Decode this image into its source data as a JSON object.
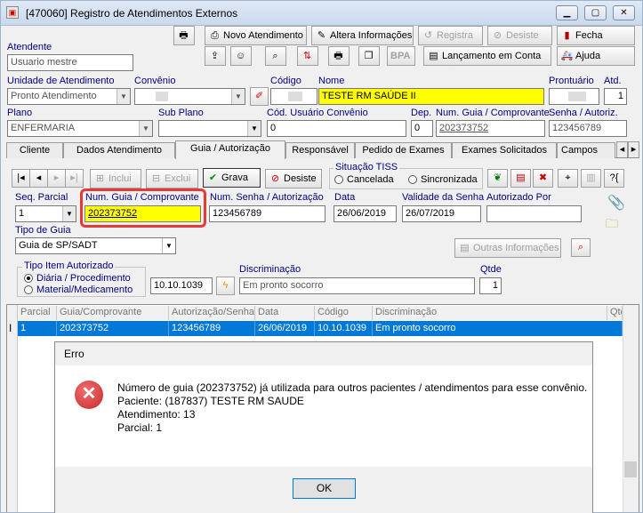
{
  "window": {
    "title": "[470060]  Registro de Atendimentos Externos"
  },
  "toolbar": {
    "novo": "Novo Atendimento",
    "alterar": "Altera Informações",
    "registra": "Registra",
    "desiste": "Desiste",
    "fecha": "Fecha",
    "bpa": "BPA",
    "lancamento": "Lançamento em Conta",
    "ajuda": "Ajuda"
  },
  "header": {
    "atendente_label": "Atendente",
    "atendente_value": "Usuario mestre",
    "unidade_label": "Unidade de Atendimento",
    "unidade_value": "Pronto Atendimento",
    "convenio_label": "Convênio",
    "codigo_label": "Código",
    "nome_label": "Nome",
    "nome_value": "TESTE RM SAÚDE II",
    "prontuario_label": "Prontuário",
    "atd_label": "Atd.",
    "atd_value": "1",
    "plano_label": "Plano",
    "plano_value": "ENFERMARIA",
    "subplano_label": "Sub Plano",
    "codusuario_label": "Cód. Usuário Convênio",
    "codusuario_value": "0",
    "dep_label": "Dep.",
    "dep_value": "0",
    "numguia_label": "Num. Guia / Comprovante",
    "numguia_value": "202373752",
    "senha_label": "Senha / Autoriz.",
    "senha_value": "123456789"
  },
  "tabs": [
    "Cliente",
    "Dados Atendimento",
    "Guia / Autorização",
    "Responsável",
    "Pedido de Exames",
    "Exames Solicitados",
    "Campos Com"
  ],
  "guia": {
    "incluir": "Inclui",
    "excluir": "Exclui",
    "grava": "Grava",
    "desiste": "Desiste",
    "situacao_label": "Situação TISS",
    "cancelada": "Cancelada",
    "sincronizada": "Sincronizada",
    "seq_label": "Seq. Parcial",
    "seq_value": "1",
    "numguia_label": "Num. Guia / Comprovante",
    "numguia_value": "202373752",
    "numsenha_label": "Num. Senha / Autorização",
    "numsenha_value": "123456789",
    "data_label": "Data",
    "data_value": "26/06/2019",
    "validade_label": "Validade da Senha",
    "validade_value": "26/07/2019",
    "autorizado_label": "Autorizado Por",
    "tipoguia_label": "Tipo de Guia",
    "tipoguia_value": "Guia de SP/SADT",
    "outras": "Outras Informações",
    "tipoitem_label": "Tipo Item Autorizado",
    "diaria": "Diária / Procedimento",
    "material": "Material/Medicamento",
    "codigo_value": "10.10.1039",
    "discriminacao_label": "Discriminação",
    "discriminacao_value": "Em pronto socorro",
    "qtde_label": "Qtde",
    "qtde_value": "1"
  },
  "grid": {
    "headers": [
      "Parcial",
      "Guia/Comprovante",
      "Autorização/Senha",
      "Data",
      "Código",
      "Discriminação",
      "Qtd"
    ],
    "row": [
      "1",
      "202373752",
      "123456789",
      "26/06/2019",
      "10.10.1039",
      "Em pronto socorro"
    ]
  },
  "dialog": {
    "title": "Erro",
    "line1": "Número de guia (202373752) já utilizada para outros pacientes / atendimentos para esse convênio.",
    "line2": "Paciente: (187837) TESTE RM SAUDE",
    "line3": "Atendimento: 13",
    "line4": "Parcial: 1",
    "ok": "OK"
  },
  "colors": {
    "highlight": "#ffff00",
    "selection": "#0078d7",
    "error": "#d32f2f",
    "callout": "#e53935"
  }
}
